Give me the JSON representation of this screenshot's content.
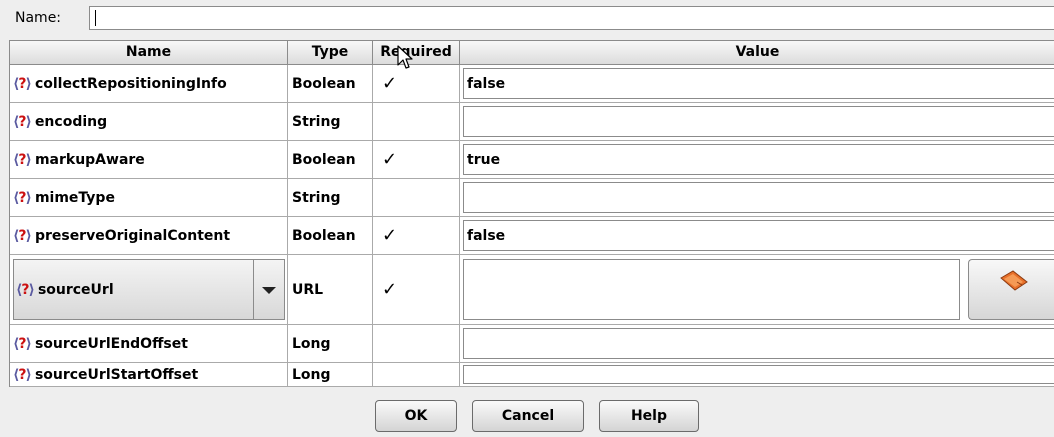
{
  "name_field": {
    "label": "Name:",
    "value": ""
  },
  "columns": [
    "Name",
    "Type",
    "Required",
    "Value"
  ],
  "rows": [
    {
      "name": "collectRepositioningInfo",
      "type": "Boolean",
      "required": "✓",
      "value": "false"
    },
    {
      "name": "encoding",
      "type": "String",
      "required": "",
      "value": ""
    },
    {
      "name": "markupAware",
      "type": "Boolean",
      "required": "✓",
      "value": "true"
    },
    {
      "name": "mimeType",
      "type": "String",
      "required": "",
      "value": ""
    },
    {
      "name": "preserveOriginalContent",
      "type": "Boolean",
      "required": "✓",
      "value": "false"
    },
    {
      "name": "sourceUrl",
      "type": "URL",
      "required": "✓",
      "value": ""
    },
    {
      "name": "sourceUrlEndOffset",
      "type": "Long",
      "required": "",
      "value": ""
    },
    {
      "name": "sourceUrlStartOffset",
      "type": "Long",
      "required": "",
      "value": ""
    }
  ],
  "help_icon": {
    "glyph_open": "⟨",
    "glyph_q": "?",
    "glyph_close": "⟩"
  },
  "buttons": {
    "ok": "OK",
    "cancel": "Cancel",
    "help": "Help"
  },
  "colors": {
    "help_bracket": "#5a5aa0",
    "help_question": "#cc1111",
    "browse_icon": "#e8702a"
  }
}
